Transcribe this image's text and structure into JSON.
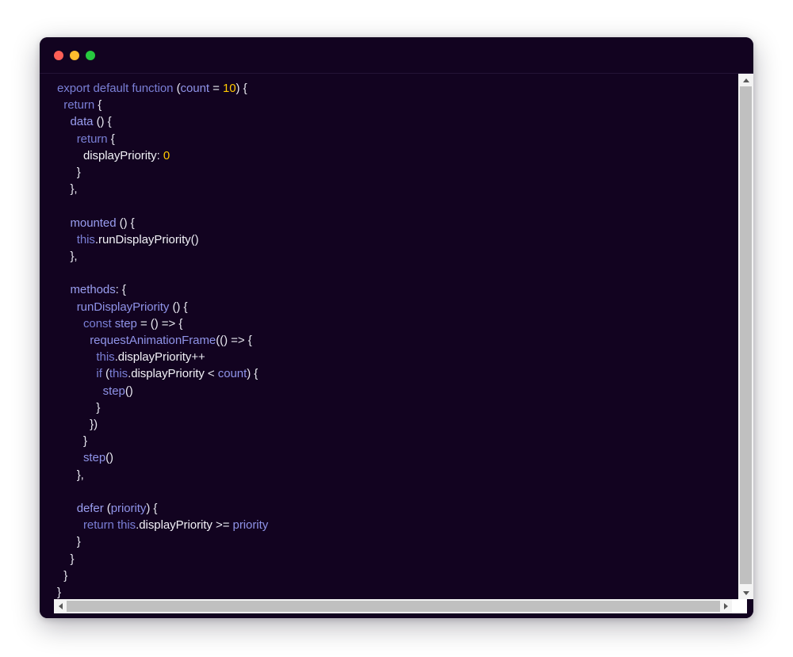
{
  "window": {
    "title": "",
    "controls": [
      {
        "name": "close",
        "label": "Close",
        "color": "#ff5f56"
      },
      {
        "name": "minimize",
        "label": "Minimize",
        "color": "#ffbd2e"
      },
      {
        "name": "maximize",
        "label": "Maximize",
        "color": "#27c93f"
      }
    ],
    "background": "#120320",
    "accent_number_color": "#ffc800",
    "accent_keyword_color": "#7a7fd6",
    "text_color": "#f2f2f7"
  },
  "editor": {
    "language": "javascript",
    "code_lines": [
      "export default function (count = 10) {",
      "  return {",
      "    data () {",
      "      return {",
      "        displayPriority: 0",
      "      }",
      "    },",
      "",
      "    mounted () {",
      "      this.runDisplayPriority()",
      "    },",
      "",
      "    methods: {",
      "      runDisplayPriority () {",
      "        const step = () => {",
      "          requestAnimationFrame(() => {",
      "            this.displayPriority++",
      "            if (this.displayPriority < count) {",
      "              step()",
      "            }",
      "          })",
      "        }",
      "        step()",
      "      },",
      "",
      "      defer (priority) {",
      "        return this.displayPriority >= priority",
      "      }",
      "    }",
      "  }",
      "}"
    ]
  },
  "scrollbars": {
    "vertical": {
      "up_arrow": "▲",
      "down_arrow": "▼",
      "thumb_position_percent": 0,
      "thumb_size_percent": 97
    },
    "horizontal": {
      "left_arrow": "◀",
      "right_arrow": "▶",
      "thumb_position_percent": 0,
      "thumb_size_percent": 96
    }
  }
}
